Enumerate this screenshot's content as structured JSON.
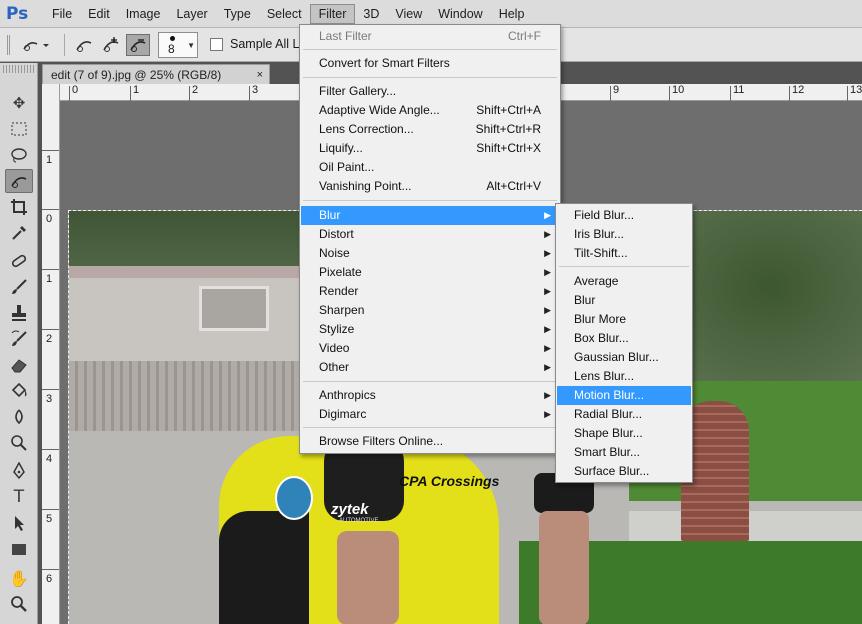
{
  "app": {
    "logo": "Ps"
  },
  "menubar": {
    "items": [
      "File",
      "Edit",
      "Image",
      "Layer",
      "Type",
      "Select",
      "Filter",
      "3D",
      "View",
      "Window",
      "Help"
    ],
    "active": "Filter"
  },
  "options": {
    "brush_size": "8",
    "sample_all_label": "Sample All L"
  },
  "document": {
    "tab_title": "edit (7 of 9).jpg @ 25% (RGB/8)",
    "close_glyph": "×"
  },
  "rulers": {
    "top": [
      "0",
      "1",
      "2",
      "3",
      "9",
      "10",
      "11",
      "12",
      "13"
    ],
    "left": [
      "1",
      "0",
      "1",
      "2",
      "3",
      "4",
      "5",
      "6"
    ]
  },
  "filter_menu": {
    "last_filter": {
      "label": "Last Filter",
      "shortcut": "Ctrl+F"
    },
    "smart_filters": "Convert for Smart Filters",
    "group1": [
      {
        "label": "Filter Gallery...",
        "shortcut": ""
      },
      {
        "label": "Adaptive Wide Angle...",
        "shortcut": "Shift+Ctrl+A"
      },
      {
        "label": "Lens Correction...",
        "shortcut": "Shift+Ctrl+R"
      },
      {
        "label": "Liquify...",
        "shortcut": "Shift+Ctrl+X"
      },
      {
        "label": "Oil Paint...",
        "shortcut": ""
      },
      {
        "label": "Vanishing Point...",
        "shortcut": "Alt+Ctrl+V"
      }
    ],
    "group2": [
      "Blur",
      "Distort",
      "Noise",
      "Pixelate",
      "Render",
      "Sharpen",
      "Stylize",
      "Video",
      "Other"
    ],
    "group3": [
      "Anthropics",
      "Digimarc"
    ],
    "browse": "Browse Filters Online...",
    "highlighted": "Blur"
  },
  "blur_menu": {
    "gallery": [
      "Field Blur...",
      "Iris Blur...",
      "Tilt-Shift..."
    ],
    "classic": [
      "Average",
      "Blur",
      "Blur More",
      "Box Blur...",
      "Gaussian Blur...",
      "Lens Blur...",
      "Motion Blur...",
      "Radial Blur...",
      "Shape Blur...",
      "Smart Blur...",
      "Surface Blur..."
    ],
    "highlighted": "Motion Blur..."
  },
  "photo": {
    "jersey_text": "CPA Crossings",
    "sleeve_text": "zytek",
    "sleeve_sub": "AUTOMOTIVE"
  },
  "colors": {
    "menu_highlight": "#3399ff",
    "ps_blue": "#2a63c0",
    "jersey_yellow": "#e3e01a"
  }
}
